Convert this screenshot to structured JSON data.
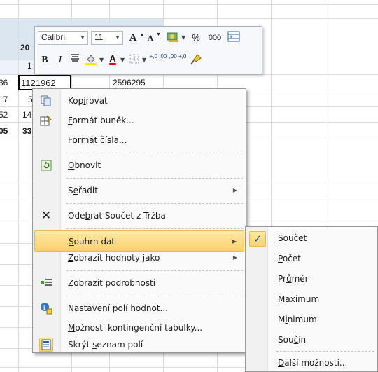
{
  "sheet": {
    "cells": [
      {
        "key": "r1",
        "text": "20"
      },
      {
        "key": "r2",
        "text": "1"
      },
      {
        "key": "r3a",
        "text": "36"
      },
      {
        "key": "r3b",
        "text": "1121962"
      },
      {
        "key": "r3c",
        "text": "2596295"
      },
      {
        "key": "r4a",
        "text": "17"
      },
      {
        "key": "r4b",
        "text": "5"
      },
      {
        "key": "r5a",
        "text": "52"
      },
      {
        "key": "r5b",
        "text": "14"
      },
      {
        "key": "r6a",
        "text": "05"
      },
      {
        "key": "r6b",
        "text": "33"
      }
    ]
  },
  "mini_toolbar": {
    "font_name": "Calibri",
    "font_size": "11",
    "grow_font": "A",
    "shrink_font": "A",
    "percent": "%",
    "thousands": "000",
    "bold": "B",
    "italic": "I",
    "font_color_letter": "A",
    "inc_decimal": "+,0 ,00",
    "dec_decimal": ",00 +,0"
  },
  "context_menu": {
    "items": [
      {
        "pre": "Kop",
        "ul": "í",
        "post": "rovat",
        "icon": "copy-icon"
      },
      {
        "pre": "",
        "ul": "F",
        "post": "ormát buněk...",
        "icon": "format-cells-icon"
      },
      {
        "pre": "Fo",
        "ul": "r",
        "post": "mát čísla...",
        "icon": ""
      },
      {
        "pre": "",
        "ul": "O",
        "post": "bnovit",
        "icon": "refresh-icon"
      },
      {
        "pre": "S",
        "ul": "e",
        "post": "řadit",
        "icon": ""
      },
      {
        "pre": "Ode",
        "ul": "b",
        "post": "rat Součet z Tržba",
        "icon": "remove-icon"
      },
      {
        "pre": "",
        "ul": "S",
        "post": "ouhrn dat",
        "icon": ""
      },
      {
        "pre": "",
        "ul": "Z",
        "post": "obrazit hodnoty jako",
        "icon": ""
      },
      {
        "pre": "",
        "ul": "Z",
        "post": "obrazit podrobnosti",
        "icon": "show-details-icon"
      },
      {
        "pre": "",
        "ul": "N",
        "post": "astavení polí hodnot...",
        "icon": "field-settings-icon"
      },
      {
        "pre": "",
        "ul": "M",
        "post": "ožnosti kontingenční tabulky...",
        "icon": ""
      },
      {
        "pre": "Skrýt ",
        "ul": "s",
        "post": "eznam polí",
        "icon": "field-list-icon"
      }
    ]
  },
  "submenu": {
    "checkmark": "✓",
    "items": [
      {
        "pre": "",
        "ul": "S",
        "post": "oučet"
      },
      {
        "pre": "",
        "ul": "P",
        "post": "očet"
      },
      {
        "pre": "Pr",
        "ul": "ů",
        "post": "měr"
      },
      {
        "pre": "",
        "ul": "M",
        "post": "aximum"
      },
      {
        "pre": "M",
        "ul": "i",
        "post": "nimum"
      },
      {
        "pre": "Sou",
        "ul": "č",
        "post": "in"
      },
      {
        "pre": "",
        "ul": "D",
        "post": "alší možnosti..."
      }
    ]
  },
  "colors": {
    "highlight_top": "#fde9a5",
    "highlight_bottom": "#fcd16e",
    "band": "#dce6f1",
    "check": "#1f4a9a"
  }
}
